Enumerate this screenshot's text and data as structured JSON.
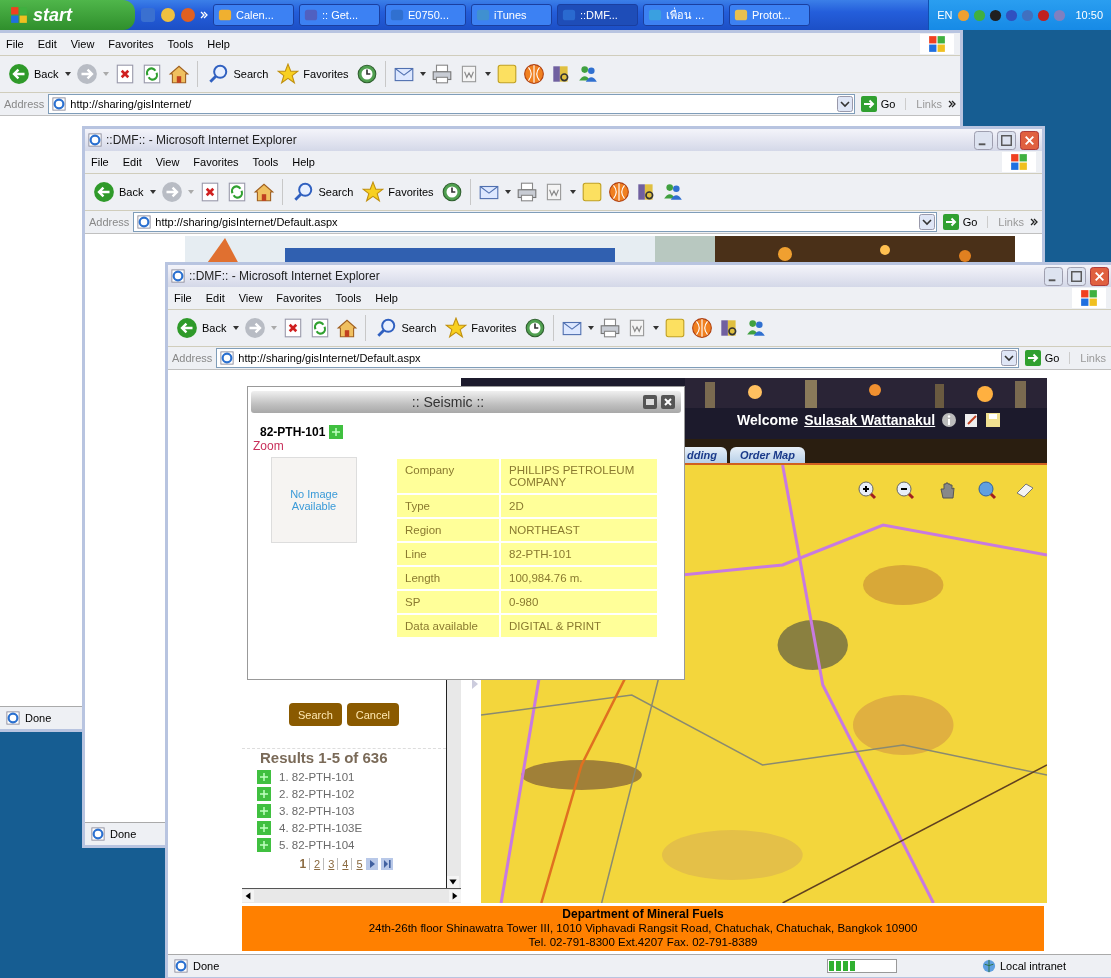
{
  "taskbar": {
    "start": "start",
    "tasks": [
      {
        "label": "Calen...",
        "selected": false
      },
      {
        "label": ":: Get...",
        "selected": false
      },
      {
        "label": "E0750...",
        "selected": false
      },
      {
        "label": "iTunes",
        "selected": false
      },
      {
        "label": "::DMF...",
        "selected": true
      },
      {
        "label": "เพื่อน ...",
        "selected": false
      },
      {
        "label": "Protot...",
        "selected": false
      }
    ],
    "tray": {
      "language": "EN",
      "time": "10:50"
    }
  },
  "windows": [
    {
      "menu": [
        "File",
        "Edit",
        "View",
        "Favorites",
        "Tools",
        "Help"
      ],
      "toolbar": {
        "back": "Back",
        "search": "Search",
        "favorites": "Favorites"
      },
      "address": {
        "label": "Address",
        "url": "http://sharing/gisInternet/",
        "go": "Go",
        "links": "Links",
        "more_links": true
      },
      "status": {
        "text": "Done"
      }
    },
    {
      "title": "::DMF:: - Microsoft Internet Explorer",
      "menu": [
        "File",
        "Edit",
        "View",
        "Favorites",
        "Tools",
        "Help"
      ],
      "toolbar": {
        "back": "Back",
        "search": "Search",
        "favorites": "Favorites"
      },
      "address": {
        "label": "Address",
        "url": "http://sharing/gisInternet/Default.aspx",
        "go": "Go",
        "links": "Links",
        "more_links": true
      },
      "status": {
        "text": "Done"
      }
    },
    {
      "title": "::DMF:: - Microsoft Internet Explorer",
      "menu": [
        "File",
        "Edit",
        "View",
        "Favorites",
        "Tools",
        "Help"
      ],
      "toolbar": {
        "back": "Back",
        "search": "Search",
        "favorites": "Favorites"
      },
      "address": {
        "label": "Address",
        "url": "http://sharing/gisInternet/Default.aspx",
        "go": "Go",
        "links": "Links",
        "more_links": false
      },
      "status": {
        "text": "Done",
        "progress": {
          "level": 0.4
        },
        "zone": "Local intranet"
      },
      "page": {
        "header": {
          "welcome": "Welcome",
          "user": "Sulasak Wattanakul"
        },
        "tabs": [
          "dding",
          "Order Map"
        ],
        "popup": {
          "title": ":: Seismic ::",
          "line": "82-PTH-101",
          "zoom": "Zoom",
          "no_image": "No Image Available",
          "fields": [
            {
              "label": "Company",
              "value": "PHILLIPS PETROLEUM COMPANY"
            },
            {
              "label": "Type",
              "value": "2D"
            },
            {
              "label": "Region",
              "value": "NORTHEAST"
            },
            {
              "label": "Line",
              "value": "82-PTH-101"
            },
            {
              "label": "Length",
              "value": "100,984.76 m."
            },
            {
              "label": "SP",
              "value": "0-980"
            },
            {
              "label": "Data available",
              "value": "DIGITAL & PRINT"
            }
          ]
        },
        "buttons": [
          "Search",
          "Cancel"
        ],
        "results": {
          "title": "Results 1-5 of 636",
          "items": [
            "1. 82-PTH-101",
            "2. 82-PTH-102",
            "3. 82-PTH-103",
            "4. 82-PTH-103E",
            "5. 82-PTH-104"
          ],
          "pages": [
            {
              "label": "1",
              "selected": true
            },
            {
              "label": "2",
              "selected": false
            },
            {
              "label": "3",
              "selected": false
            },
            {
              "label": "4",
              "selected": false
            },
            {
              "label": "5",
              "selected": false
            }
          ]
        },
        "footer": {
          "org": "Department of Mineral Fuels",
          "address": "24th-26th floor Shinawatra Tower III, 1010 Viphavadi Rangsit Road, Chatuchak, Chatuchak, Bangkok 10900",
          "contact": "Tel. 02-791-8300 Ext.4207 Fax. 02-791-8389"
        }
      }
    }
  ]
}
